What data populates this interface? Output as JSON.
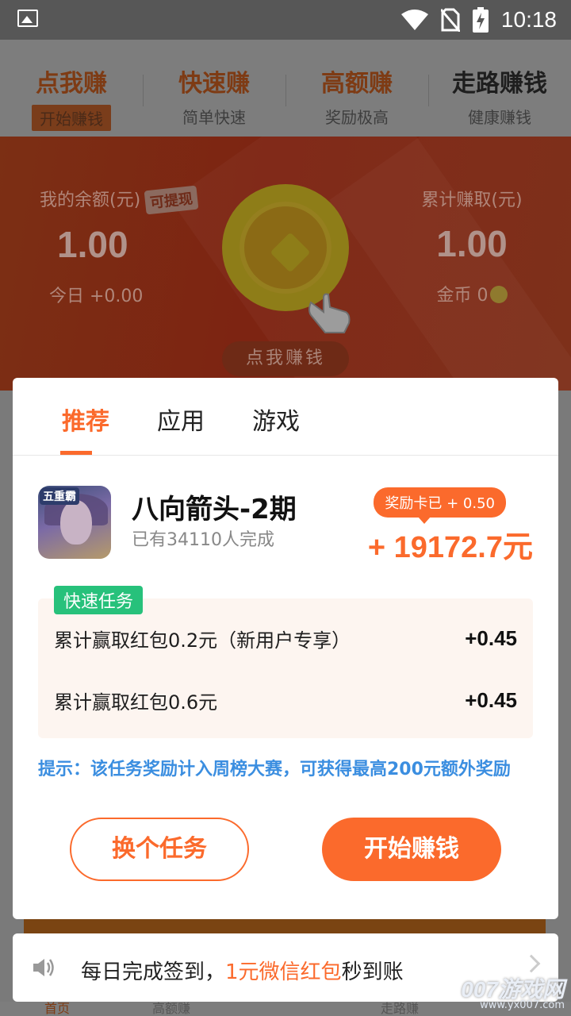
{
  "status_bar": {
    "time": "10:18"
  },
  "top_nav": [
    {
      "title": "点我赚",
      "subtitle": "开始赚钱"
    },
    {
      "title": "快速赚",
      "subtitle": "简单快速"
    },
    {
      "title": "高额赚",
      "subtitle": "奖励极高"
    },
    {
      "title": "走路赚钱",
      "subtitle": "健康赚钱"
    }
  ],
  "banner": {
    "balance_label": "我的余额(元)",
    "withdraw_badge": "可提现",
    "balance": "1.00",
    "today": "今日 +0.00",
    "total_label": "累计赚取(元)",
    "total": "1.00",
    "coins": "金币 0",
    "cta": "点我赚钱"
  },
  "modal": {
    "tabs": [
      "推荐",
      "应用",
      "游戏"
    ],
    "active_tab": "推荐",
    "task": {
      "icon_tag": "五重霸",
      "title": "八向箭头-2期",
      "completed": "已有34110人完成",
      "reward_pill": "奖励卡已 + 0.50",
      "reward_amount": "+ 19172.7元"
    },
    "quick_tasks": {
      "badge": "快速任务",
      "items": [
        {
          "label": "累计赢取红包0.2元（新用户专享）",
          "value": "+0.45"
        },
        {
          "label": "累计赢取红包0.6元",
          "value": "+0.45"
        }
      ]
    },
    "tip": "提示：该任务奖励计入周榜大赛，可获得最高200元额外奖励",
    "switch_button": "换个任务",
    "start_button": "开始赚钱"
  },
  "notice": {
    "prefix": "每日完成签到，",
    "highlight": "1元微信红包",
    "suffix": "秒到账"
  },
  "bottom_nav": [
    "首页",
    "高额赚",
    "",
    "走路赚",
    ""
  ],
  "watermark": {
    "brand": "007游戏网",
    "url": "www.yx007.com"
  },
  "colors": {
    "accent": "#fb6a2c",
    "quick_badge": "#27c17b",
    "tip": "#3b8ee0"
  }
}
